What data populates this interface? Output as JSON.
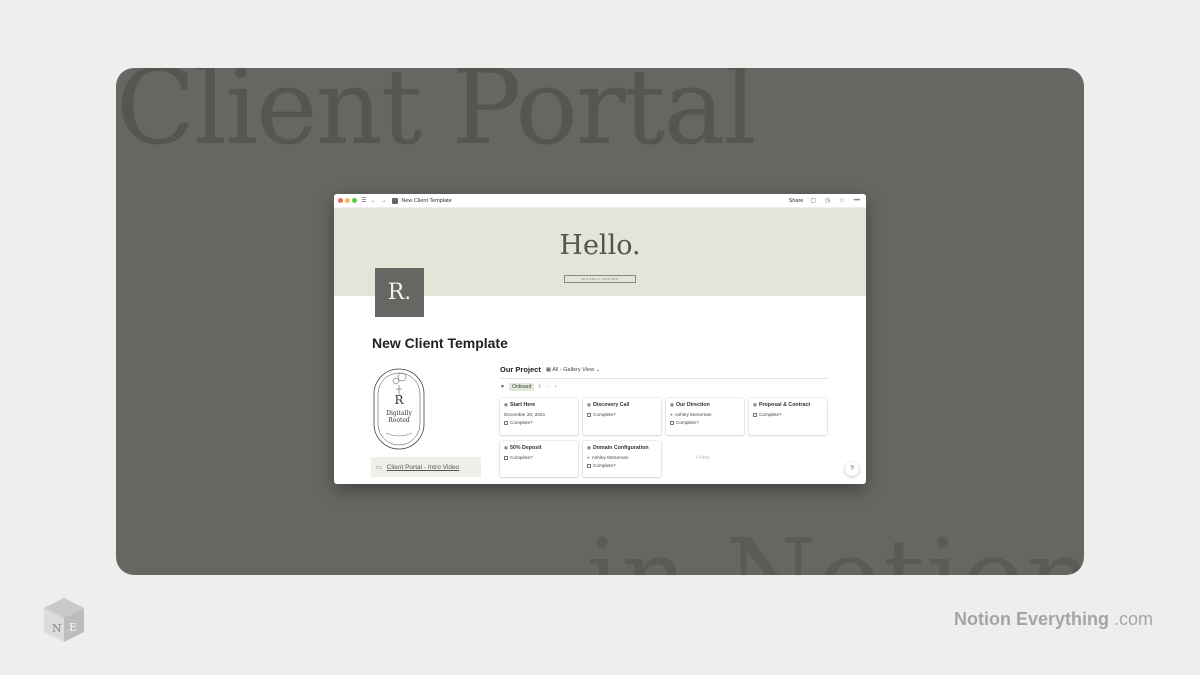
{
  "background": {
    "title": "Client Portal",
    "subtitle": "in Notion"
  },
  "window": {
    "tab_title": "New Client Template",
    "share_label": "Share"
  },
  "cover": {
    "hello": "Hello.",
    "badge": "DIGITALLY ROOTED"
  },
  "page": {
    "logo_letter": "R.",
    "title": "New Client Template",
    "seal_letter": "R",
    "seal_line1": "Digitally",
    "seal_line2": "Rooted",
    "intro_video": "Client Portal - Intro Video"
  },
  "project": {
    "title": "Our Project",
    "view_label": "All - Gallery View",
    "group_label": "Onboard",
    "group_count": "6",
    "new_label": "+ New",
    "cards": [
      {
        "title": "Start Here",
        "line1": "December 20, 2021",
        "line2": "Complete?"
      },
      {
        "title": "Discovery Call",
        "line1": "Complete?"
      },
      {
        "title": "Our Direction",
        "line1": "Ashley McKernan",
        "line2": "Complete?"
      },
      {
        "title": "Proposal & Contract",
        "line1": "Complete?"
      },
      {
        "title": "50% Deposit",
        "line1": "Complete?"
      },
      {
        "title": "Domain Configuration",
        "line1": "Ashley McKernan",
        "line2": "Complete?"
      }
    ]
  },
  "help_label": "?",
  "branding": {
    "name": "Notion Everything",
    "domain": ".com",
    "logo_letters": "NE"
  },
  "colors": {
    "accent": "#666762",
    "cover": "#e5e4d9",
    "group_tag": "#dfe8da"
  }
}
